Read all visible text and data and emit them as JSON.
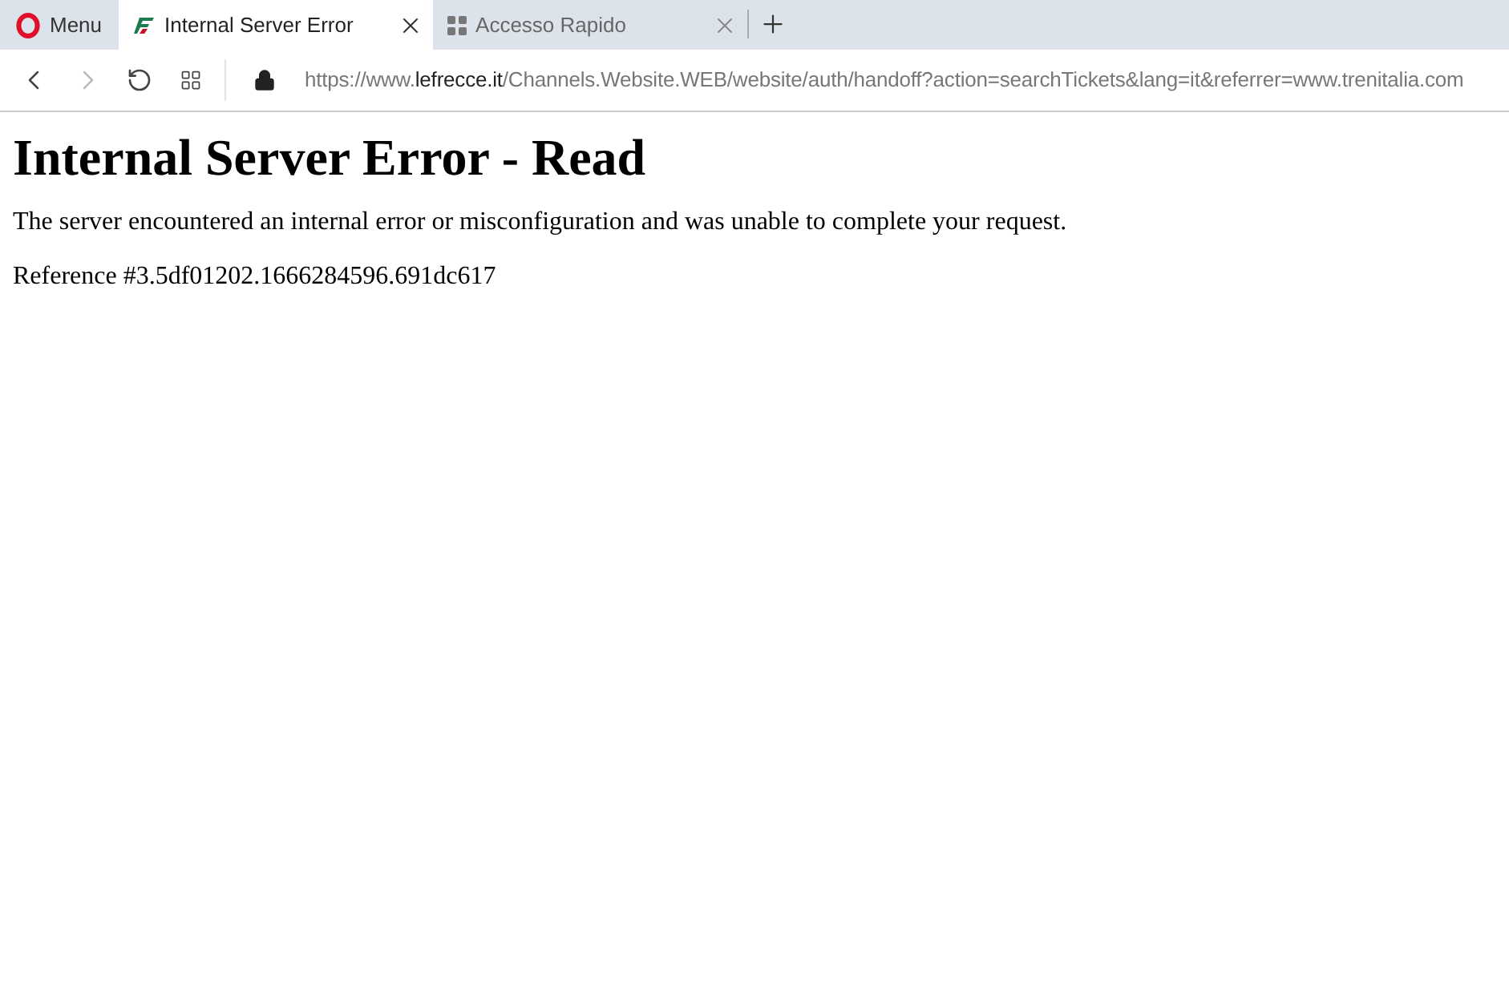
{
  "browser": {
    "menu_label": "Menu",
    "tabs": [
      {
        "title": "Internal Server Error",
        "selected": true,
        "kind": "site"
      },
      {
        "title": "Accesso Rapido",
        "selected": false,
        "kind": "speeddial"
      }
    ],
    "address": {
      "prefix": "https://www.",
      "host": "lefrecce.it",
      "path": "/Channels.Website.WEB/website/auth/handoff?action=searchTickets&lang=it&referrer=www.trenitalia.com"
    }
  },
  "page": {
    "heading": "Internal Server Error - Read",
    "paragraphs": [
      "The server encountered an internal error or misconfiguration and was unable to complete your request.",
      "Reference #3.5df01202.1666284596.691dc617"
    ]
  }
}
